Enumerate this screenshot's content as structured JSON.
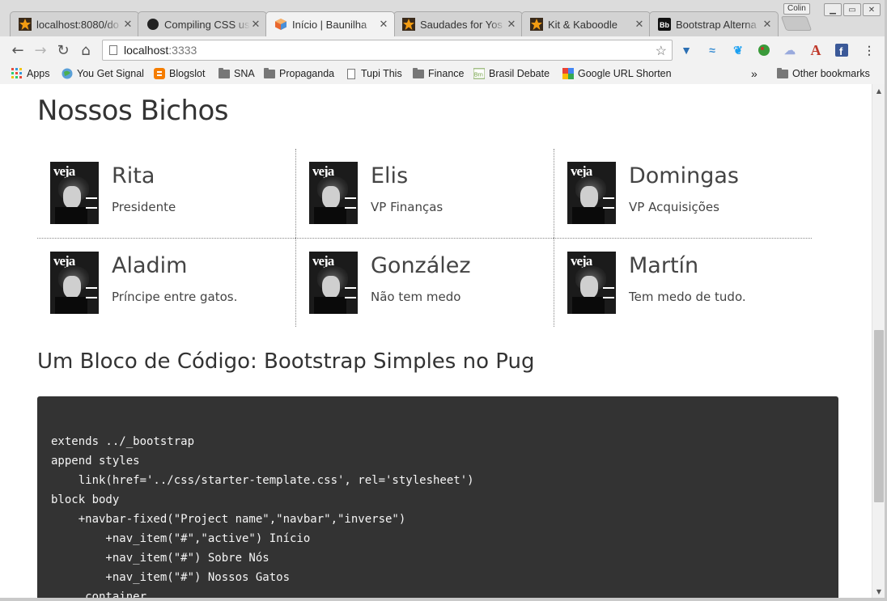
{
  "browser": {
    "tabs": [
      {
        "title": "localhost:8080/do",
        "icon": "star-burst-icon",
        "active": false
      },
      {
        "title": "Compiling CSS us",
        "icon": "github-icon",
        "active": false
      },
      {
        "title": "Início | Baunilha",
        "icon": "cube-icon",
        "active": true
      },
      {
        "title": "Saudades for Yos",
        "icon": "star-burst-icon",
        "active": false
      },
      {
        "title": "Kit & Kaboodle",
        "icon": "star-burst-icon",
        "active": false
      },
      {
        "title": "Bootstrap Alterna",
        "icon": "bootstrap-icon",
        "active": false
      }
    ],
    "close_glyph": "✕",
    "user_name": "Colin",
    "url_host": "localhost",
    "url_port": ":3333",
    "bookmarks": [
      {
        "label": "Apps",
        "icon": "apps-grid-icon"
      },
      {
        "label": "You Get Signal",
        "icon": "globe-icon"
      },
      {
        "label": "Blogslot",
        "icon": "blogger-icon"
      },
      {
        "label": "SNA",
        "icon": "folder-icon"
      },
      {
        "label": "Propaganda",
        "icon": "folder-icon"
      },
      {
        "label": "Tupi This",
        "icon": "page-icon"
      },
      {
        "label": "Finance",
        "icon": "folder-icon"
      },
      {
        "label": "Brasil Debate",
        "icon": "brasil-debate-icon"
      },
      {
        "label": "Google URL Shortene",
        "icon": "google-icon"
      }
    ],
    "bookmarks_overflow": "»",
    "other_bookmarks": "Other bookmarks",
    "colors": {
      "chrome_bg": "#dcdcdc",
      "tab_active": "#f2f2f2",
      "accent_orange": "#e8672e"
    }
  },
  "page": {
    "section_title": "Nossos Bichos",
    "cat_thumb_text": "veja",
    "members": [
      {
        "name": "Rita",
        "role": "Presidente"
      },
      {
        "name": "Elis",
        "role": "VP Finanças"
      },
      {
        "name": "Domingas",
        "role": "VP Acquisições"
      },
      {
        "name": "Aladim",
        "role": "Príncipe entre gatos."
      },
      {
        "name": "González",
        "role": "Não tem medo"
      },
      {
        "name": "Martín",
        "role": "Tem medo de tudo."
      }
    ],
    "code_title": "Um Bloco de Código: Bootstrap Simples no Pug",
    "code_lines": [
      "extends ../_bootstrap",
      "append styles",
      "    link(href='../css/starter-template.css', rel='stylesheet')",
      "block body",
      "    +navbar-fixed(\"Project name\",\"navbar\",\"inverse\")",
      "        +nav_item(\"#\",\"active\") Início",
      "        +nav_item(\"#\") Sobre Nós",
      "        +nav_item(\"#\") Nossos Gatos",
      "    .container"
    ],
    "colors": {
      "code_bg": "#333333",
      "code_text": "#f5f5f5",
      "heading": "#333333"
    }
  }
}
